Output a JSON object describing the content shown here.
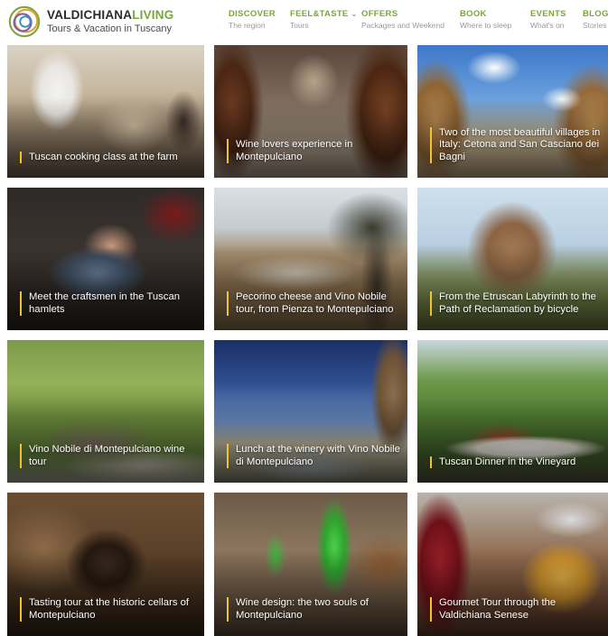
{
  "brand": {
    "name_part1": "VALDICHIANA",
    "name_part2": "LIVING",
    "tagline": "Tours & Vacation in Tuscany"
  },
  "nav": [
    {
      "label": "DISCOVER",
      "sub": "The region"
    },
    {
      "label": "FEEL&TASTE",
      "sub": "Tours",
      "has_dropdown": true
    },
    {
      "label": "OFFERS",
      "sub": "Packages and Weekend"
    },
    {
      "label": "BOOK",
      "sub": "Where to sleep"
    },
    {
      "label": "EVENTS",
      "sub": "What's on"
    },
    {
      "label": "BLOG",
      "sub": "Stories"
    }
  ],
  "tours": [
    {
      "title": "Tuscan cooking class at the farm"
    },
    {
      "title": "Wine lovers experience in Montepulciano"
    },
    {
      "title": "Two of the most beautiful villages in Italy: Cetona and San Casciano dei Bagni"
    },
    {
      "title": "Meet the craftsmen in the Tuscan hamlets"
    },
    {
      "title": "Pecorino cheese and Vino Nobile tour, from Pienza to Montepulciano"
    },
    {
      "title": "From the Etruscan Labyrinth to the Path of Reclamation by bicycle"
    },
    {
      "title": "Vino Nobile di Montepulciano wine tour"
    },
    {
      "title": "Lunch at the winery with Vino Nobile di Montepulciano"
    },
    {
      "title": "Tuscan Dinner in the Vineyard"
    },
    {
      "title": "Tasting tour at the historic cellars of Montepulciano"
    },
    {
      "title": "Wine design: the two souls of Montepulciano"
    },
    {
      "title": "Gourmet Tour through the Valdichiana Senese"
    }
  ],
  "colors": {
    "accent_green": "#7aa63c",
    "caption_bar": "#f2c230"
  }
}
